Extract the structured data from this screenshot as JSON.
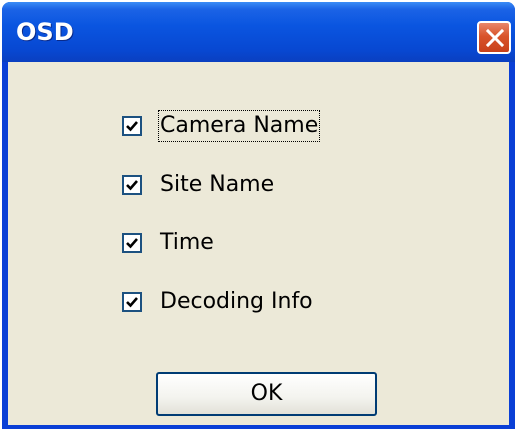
{
  "window": {
    "title": "OSD"
  },
  "checkboxes": [
    {
      "label": "Camera Name",
      "checked": true,
      "focused": true
    },
    {
      "label": "Site Name",
      "checked": true
    },
    {
      "label": "Time",
      "checked": true
    },
    {
      "label": "Decoding Info",
      "checked": true
    }
  ],
  "buttons": {
    "ok_label": "OK"
  },
  "icons": {
    "close": "close-icon",
    "check": "checkmark-icon"
  },
  "colors": {
    "titlebar": "#0a55e0",
    "client_bg": "#ece9d8",
    "close_button": "#d9542b"
  }
}
